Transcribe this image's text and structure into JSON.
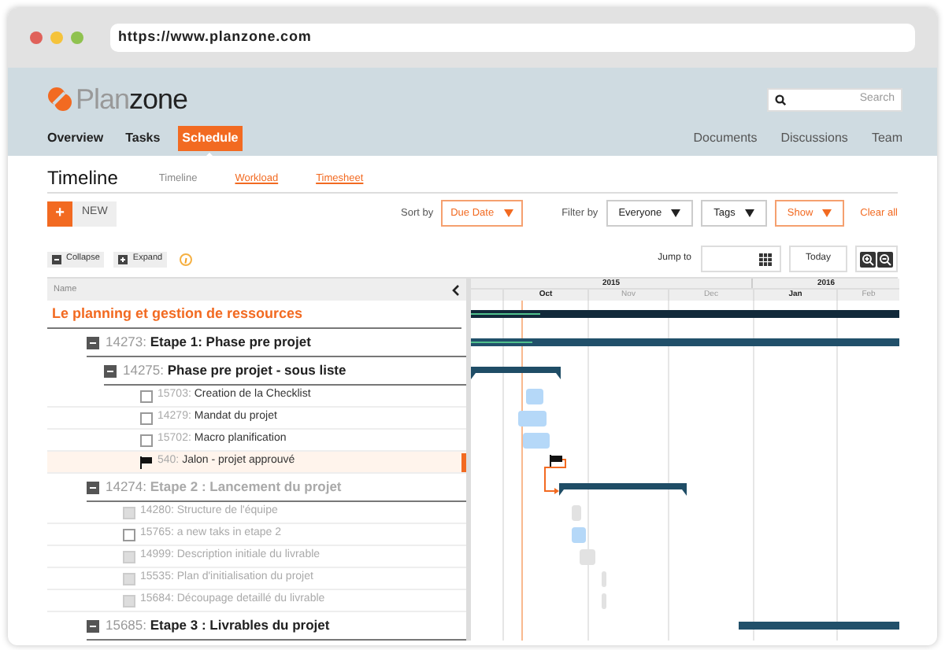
{
  "browser": {
    "url": "https://www.planzone.com"
  },
  "header": {
    "logo": {
      "part_1": "Plan",
      "part_2": "zone"
    },
    "search": {
      "placeholder": "Search"
    },
    "nav": [
      {
        "label": "Overview",
        "selected": false
      },
      {
        "label": "Tasks",
        "selected": false
      },
      {
        "label": "Schedule",
        "selected": true
      }
    ],
    "nav_right": [
      "Documents",
      "Discussions",
      "Team"
    ]
  },
  "page": {
    "title": "Timeline",
    "subtabs": [
      {
        "label": "Timeline",
        "selected": true
      },
      {
        "label": "Workload",
        "selected": false
      },
      {
        "label": "Timesheet",
        "selected": false
      }
    ]
  },
  "toolbar": {
    "new_icon": "+",
    "new_label": "NEW",
    "sort_label": "Sort by",
    "sort": [
      {
        "label": "Due Date",
        "active": true
      }
    ],
    "filter_label": "Filter by",
    "filters": [
      {
        "label": "Everyone",
        "active": false
      },
      {
        "label": "Tags",
        "active": false
      },
      {
        "label": "Show",
        "active": true
      }
    ],
    "clear": "Clear all"
  },
  "controls": {
    "collapse": "Collapse",
    "expand": "Expand",
    "jump_label": "Jump to",
    "today": "Today"
  },
  "timeline": {
    "years": [
      {
        "label": "2015"
      },
      {
        "label": "2016"
      }
    ],
    "months": [
      {
        "label": "Oct",
        "current": true
      },
      {
        "label": "Nov",
        "current": false
      },
      {
        "label": "Dec",
        "current": false
      },
      {
        "label": "Jan",
        "current": true
      },
      {
        "label": "Feb",
        "current": false
      }
    ]
  },
  "tree": {
    "header": "Name",
    "root": {
      "title": "Le planning et gestion de ressources",
      "children": [
        {
          "kind": "group",
          "id": "14273:",
          "title": "Etape 1: Phase pre projet",
          "dimmed": false,
          "selected": false,
          "children": [
            {
              "kind": "group",
              "id": "14275:",
              "title": "Phase pre projet - sous liste",
              "dimmed": false,
              "selected": false,
              "children": [
                {
                  "kind": "task",
                  "id": "15703:",
                  "title": "Creation de la Checklist",
                  "disabled": false,
                  "selected": false
                },
                {
                  "kind": "task",
                  "id": "14279:",
                  "title": "Mandat du projet",
                  "disabled": false,
                  "selected": false
                },
                {
                  "kind": "task",
                  "id": "15702:",
                  "title": "Macro planification",
                  "disabled": false,
                  "selected": false
                },
                {
                  "kind": "milestone",
                  "id": "540:",
                  "title": "Jalon - projet approuvé",
                  "selected": true
                }
              ]
            }
          ]
        },
        {
          "kind": "group",
          "id": "14274:",
          "title": "Etape 2 : Lancement du projet",
          "dimmed": true,
          "selected": false,
          "children": [
            {
              "kind": "task",
              "id": "14280:",
              "title": "Structure de l'équipe",
              "disabled": true,
              "selected": false
            },
            {
              "kind": "task",
              "id": "15765:",
              "title": "a new taks in etape 2",
              "disabled": false,
              "selected": false
            },
            {
              "kind": "task",
              "id": "14999:",
              "title": "Description initiale du livrable",
              "disabled": true,
              "selected": false
            },
            {
              "kind": "task",
              "id": "15535:",
              "title": "Plan d'initialisation du projet",
              "disabled": true,
              "selected": false
            },
            {
              "kind": "task",
              "id": "15684:",
              "title": "Découpage detaillé du livrable",
              "disabled": true,
              "selected": false
            }
          ]
        },
        {
          "kind": "group",
          "id": "15685:",
          "title": "Etape 3 : Livrables du projet",
          "dimmed": false,
          "selected": false
        }
      ]
    }
  }
}
